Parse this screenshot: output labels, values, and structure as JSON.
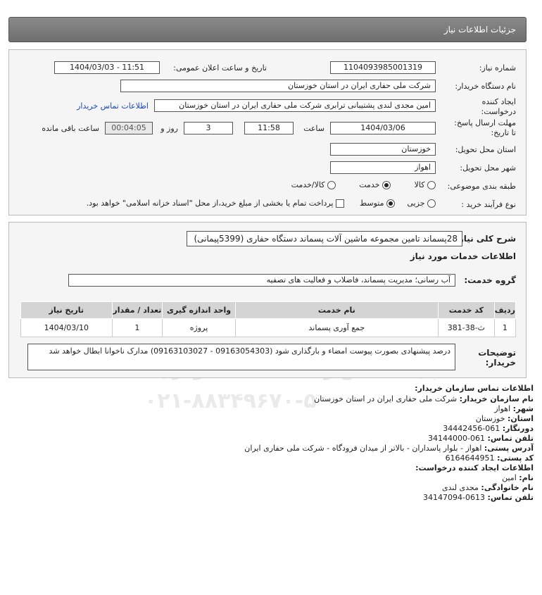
{
  "header": {
    "title": "جزئیات اطلاعات نیاز"
  },
  "form": {
    "need_number": {
      "label": "شماره نیاز:",
      "value": "1104093985001319"
    },
    "announce": {
      "label": "تاریخ و ساعت اعلان عمومی:",
      "value": "1404/03/03 - 11:51"
    },
    "buyer_org": {
      "label": "نام دستگاه خریدار:",
      "value": "شرکت ملی حفاری ایران در استان خوزستان"
    },
    "creator": {
      "label_line1": "ایجاد کننده",
      "label_line2": "درخواست:",
      "value": "امین مجدی لندی پشتیبانی ترابری شرکت ملی حفاری ایران در استان خوزستان",
      "contact_link": "اطلاعات تماس خریدار"
    },
    "deadline": {
      "label_line1": "مهلت ارسال پاسخ:",
      "label_line2": "تا تاریخ:",
      "date": "1404/03/06",
      "time_label": "ساعت",
      "time": "11:58",
      "days": "3",
      "days_label": "روز و",
      "remaining": "00:04:05",
      "remaining_label": "ساعت باقی مانده"
    },
    "province": {
      "label": "استان محل تحویل:",
      "value": "خوزستان"
    },
    "city": {
      "label": "شهر محل تحویل:",
      "value": "اهواز"
    },
    "category": {
      "label": "طبقه بندی موضوعی:",
      "options": [
        "کالا",
        "خدمت",
        "کالا/خدمت"
      ],
      "selected": "خدمت"
    },
    "process": {
      "label": "نوع فرآیند خرید :",
      "options": [
        "جزیی",
        "متوسط"
      ],
      "selected": "متوسط",
      "payment_note": "پرداخت تمام یا بخشی از مبلغ خرید،از محل \"اسناد خزانه اسلامی\" خواهد بود."
    }
  },
  "details": {
    "summary_label": "شرح کلی نیاز:",
    "summary": "28پسماند تامین مجموعه ماشین آلات پسماند دستگاه حفاری (5399پیمانی)",
    "services_title": "اطلاعات خدمات مورد نیاز",
    "service_group_label": "گروه خدمت:",
    "service_group": "آب رسانی؛ مدیریت پسماند، فاضلاب و فعالیت های تصفیه",
    "table": {
      "headers": [
        "ردیف",
        "کد خدمت",
        "نام خدمت",
        "واحد اندازه گیری",
        "تعداد / مقدار",
        "تاریخ نیاز"
      ],
      "rows": [
        [
          "1",
          "ث-38-381",
          "جمع آوری پسماند",
          "پروژه",
          "1",
          "1404/03/10"
        ]
      ]
    },
    "buyer_notes_label_line1": "توضیحات",
    "buyer_notes_label_line2": "خریدار:",
    "buyer_notes": "درصد پیشنهادی بصورت پیوست امضاء و بارگذاری شود (09163054303 - 09163103027) مدارک ناخوانا ابطال خواهد شد"
  },
  "contact": {
    "title": "اطلاعات تماس سازمان خریدار:",
    "org_label": "نام سازمان خریدار:",
    "org": "شرکت ملی حفاری ایران در استان خوزستان",
    "city_label": "شهر:",
    "city": "اهواز",
    "province_label": "استان:",
    "province": "خوزستان",
    "fax_label": "دورنگار:",
    "fax": "061-34442456",
    "phone_label": "تلفن تماس:",
    "phone": "061-34144000",
    "address_label": "آدرس پستی:",
    "address": "اهواز - بلوار پاسداران - بالاتر از میدان فرودگاه - شرکت ملی حفاری ایران",
    "postal_label": "کد پستی:",
    "postal": "6164644951",
    "creator_title": "اطلاعات ایجاد کننده درخواست:",
    "first_name_label": "نام:",
    "first_name": "امین",
    "last_name_label": "نام خانوادگی:",
    "last_name": "مجدی لندی",
    "creator_phone_label": "تلفن تماس:",
    "creator_phone": "0613-34147094"
  },
  "watermark": {
    "text1": "ParsNamadData",
    "text2": "پایگاه اطلاع رسانی مناقصه ومزایده",
    "text3": "۰۲۱-۸۸۳۴۹۶۷۰-۵"
  }
}
